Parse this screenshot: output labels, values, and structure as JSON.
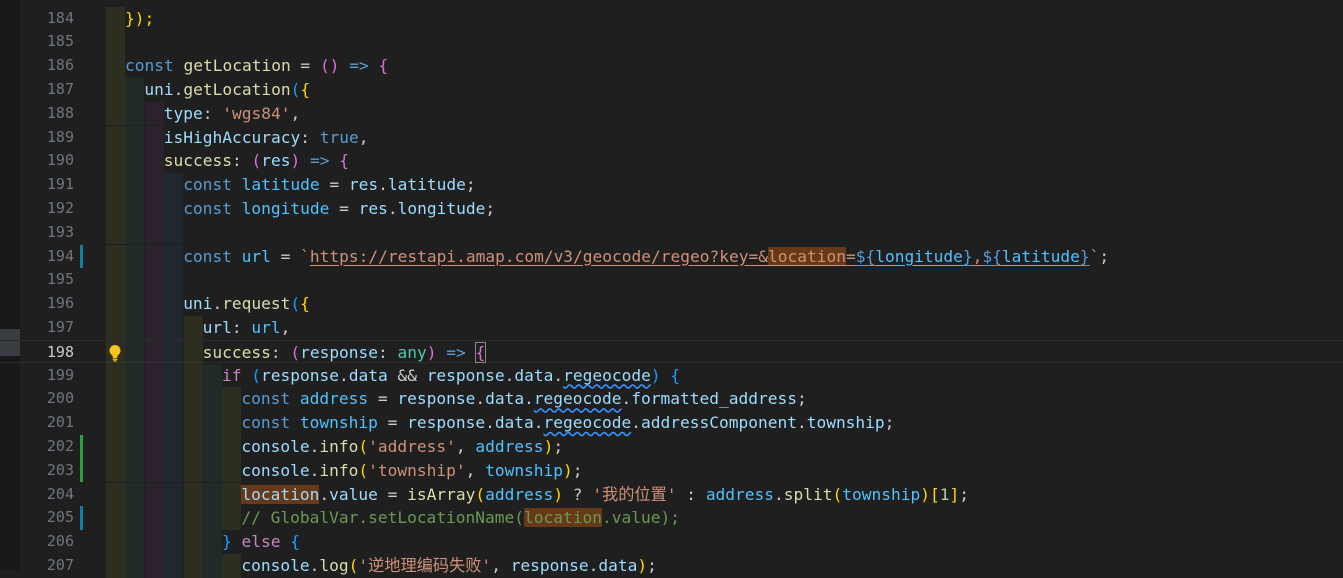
{
  "editor": {
    "lines": [
      {
        "n": "184",
        "indent": 0,
        "tokens": [
          {
            "t": "});",
            "c": "p1"
          }
        ]
      },
      {
        "n": "185",
        "indent": 0,
        "tokens": []
      },
      {
        "n": "186",
        "indent": 0,
        "tokens": [
          {
            "t": "const",
            "c": "kw"
          },
          {
            "t": " "
          },
          {
            "t": "getLocation",
            "c": "fn"
          },
          {
            "t": " = "
          },
          {
            "t": "()",
            "c": "p2"
          },
          {
            "t": " "
          },
          {
            "t": "=>",
            "c": "kw"
          },
          {
            "t": " "
          },
          {
            "t": "{",
            "c": "p2"
          }
        ]
      },
      {
        "n": "187",
        "indent": 1,
        "tokens": [
          {
            "t": "uni",
            "c": "var"
          },
          {
            "t": "."
          },
          {
            "t": "getLocation",
            "c": "fn"
          },
          {
            "t": "(",
            "c": "p3"
          },
          {
            "t": "{",
            "c": "p1"
          }
        ]
      },
      {
        "n": "188",
        "indent": 2,
        "tokens": [
          {
            "t": "type",
            "c": "var"
          },
          {
            "t": ": "
          },
          {
            "t": "'wgs84'",
            "c": "str"
          },
          {
            "t": ","
          }
        ]
      },
      {
        "n": "189",
        "indent": 2,
        "tokens": [
          {
            "t": "isHighAccuracy",
            "c": "var"
          },
          {
            "t": ": "
          },
          {
            "t": "true",
            "c": "kw"
          },
          {
            "t": ","
          }
        ]
      },
      {
        "n": "190",
        "indent": 2,
        "tokens": [
          {
            "t": "success",
            "c": "fn"
          },
          {
            "t": ": "
          },
          {
            "t": "(",
            "c": "p2"
          },
          {
            "t": "res",
            "c": "var"
          },
          {
            "t": ")",
            "c": "p2"
          },
          {
            "t": " "
          },
          {
            "t": "=>",
            "c": "kw"
          },
          {
            "t": " "
          },
          {
            "t": "{",
            "c": "p2"
          }
        ]
      },
      {
        "n": "191",
        "indent": 3,
        "tokens": [
          {
            "t": "const",
            "c": "kw"
          },
          {
            "t": " "
          },
          {
            "t": "latitude",
            "c": "cst"
          },
          {
            "t": " = "
          },
          {
            "t": "res",
            "c": "var"
          },
          {
            "t": "."
          },
          {
            "t": "latitude",
            "c": "var"
          },
          {
            "t": ";"
          }
        ]
      },
      {
        "n": "192",
        "indent": 3,
        "tokens": [
          {
            "t": "const",
            "c": "kw"
          },
          {
            "t": " "
          },
          {
            "t": "longitude",
            "c": "cst"
          },
          {
            "t": " = "
          },
          {
            "t": "res",
            "c": "var"
          },
          {
            "t": "."
          },
          {
            "t": "longitude",
            "c": "var"
          },
          {
            "t": ";"
          }
        ]
      },
      {
        "n": "193",
        "indent": 3,
        "tokens": []
      },
      {
        "n": "194",
        "indent": 3,
        "mod": "changed",
        "tokens": [
          {
            "t": "const",
            "c": "kw"
          },
          {
            "t": " "
          },
          {
            "t": "url",
            "c": "cst"
          },
          {
            "t": " = "
          },
          {
            "t": "`",
            "c": "str"
          },
          {
            "t": "https://restapi.amap.com/v3/geocode/regeo?key=&",
            "c": "str link"
          },
          {
            "t": "location",
            "c": "str link hl"
          },
          {
            "t": "=",
            "c": "str link"
          },
          {
            "t": "${",
            "c": "kw link"
          },
          {
            "t": "longitude",
            "c": "cst link"
          },
          {
            "t": "}",
            "c": "kw link"
          },
          {
            "t": ",",
            "c": "str link"
          },
          {
            "t": "${",
            "c": "kw link"
          },
          {
            "t": "latitude",
            "c": "cst link"
          },
          {
            "t": "}",
            "c": "kw link"
          },
          {
            "t": "`",
            "c": "str"
          },
          {
            "t": ";"
          }
        ]
      },
      {
        "n": "195",
        "indent": 3,
        "tokens": []
      },
      {
        "n": "196",
        "indent": 3,
        "tokens": [
          {
            "t": "uni",
            "c": "var"
          },
          {
            "t": "."
          },
          {
            "t": "request",
            "c": "fn"
          },
          {
            "t": "(",
            "c": "p3"
          },
          {
            "t": "{",
            "c": "p1"
          }
        ]
      },
      {
        "n": "197",
        "indent": 4,
        "tokens": [
          {
            "t": "url",
            "c": "var"
          },
          {
            "t": ": "
          },
          {
            "t": "url",
            "c": "cst"
          },
          {
            "t": ","
          }
        ]
      },
      {
        "n": "198",
        "indent": 4,
        "current": true,
        "bulb": true,
        "tokens": [
          {
            "t": "success",
            "c": "fn"
          },
          {
            "t": ": "
          },
          {
            "t": "(",
            "c": "p2"
          },
          {
            "t": "response",
            "c": "var"
          },
          {
            "t": ": "
          },
          {
            "t": "any",
            "c": "typ"
          },
          {
            "t": ")",
            "c": "p2"
          },
          {
            "t": " "
          },
          {
            "t": "=>",
            "c": "kw"
          },
          {
            "t": " "
          },
          {
            "t": "{",
            "c": "p2 bracket-box"
          }
        ]
      },
      {
        "n": "199",
        "indent": 5,
        "tokens": [
          {
            "t": "if",
            "c": "ctl"
          },
          {
            "t": " "
          },
          {
            "t": "(",
            "c": "p3"
          },
          {
            "t": "response",
            "c": "var"
          },
          {
            "t": "."
          },
          {
            "t": "data",
            "c": "var"
          },
          {
            "t": " && "
          },
          {
            "t": "response",
            "c": "var"
          },
          {
            "t": "."
          },
          {
            "t": "data",
            "c": "var"
          },
          {
            "t": "."
          },
          {
            "t": "regeocode",
            "c": "var squig"
          },
          {
            "t": ")",
            "c": "p3"
          },
          {
            "t": " "
          },
          {
            "t": "{",
            "c": "p3"
          }
        ]
      },
      {
        "n": "200",
        "indent": 6,
        "tokens": [
          {
            "t": "const",
            "c": "kw"
          },
          {
            "t": " "
          },
          {
            "t": "address",
            "c": "cst"
          },
          {
            "t": " = "
          },
          {
            "t": "response",
            "c": "var"
          },
          {
            "t": "."
          },
          {
            "t": "data",
            "c": "var"
          },
          {
            "t": "."
          },
          {
            "t": "regeocode",
            "c": "var squig"
          },
          {
            "t": "."
          },
          {
            "t": "formatted_address",
            "c": "var"
          },
          {
            "t": ";"
          }
        ]
      },
      {
        "n": "201",
        "indent": 6,
        "tokens": [
          {
            "t": "const",
            "c": "kw"
          },
          {
            "t": " "
          },
          {
            "t": "township",
            "c": "cst"
          },
          {
            "t": " = "
          },
          {
            "t": "response",
            "c": "var"
          },
          {
            "t": "."
          },
          {
            "t": "data",
            "c": "var"
          },
          {
            "t": "."
          },
          {
            "t": "regeocode",
            "c": "var squig"
          },
          {
            "t": "."
          },
          {
            "t": "addressComponent",
            "c": "var"
          },
          {
            "t": "."
          },
          {
            "t": "township",
            "c": "var"
          },
          {
            "t": ";"
          }
        ]
      },
      {
        "n": "202",
        "indent": 6,
        "mod": "added",
        "tokens": [
          {
            "t": "console",
            "c": "var"
          },
          {
            "t": "."
          },
          {
            "t": "info",
            "c": "fn"
          },
          {
            "t": "(",
            "c": "p1"
          },
          {
            "t": "'address'",
            "c": "str"
          },
          {
            "t": ", "
          },
          {
            "t": "address",
            "c": "cst"
          },
          {
            "t": ")",
            "c": "p1"
          },
          {
            "t": ";"
          }
        ]
      },
      {
        "n": "203",
        "indent": 6,
        "mod": "added",
        "tokens": [
          {
            "t": "console",
            "c": "var"
          },
          {
            "t": "."
          },
          {
            "t": "info",
            "c": "fn"
          },
          {
            "t": "(",
            "c": "p1"
          },
          {
            "t": "'township'",
            "c": "str"
          },
          {
            "t": ", "
          },
          {
            "t": "township",
            "c": "cst"
          },
          {
            "t": ")",
            "c": "p1"
          },
          {
            "t": ";"
          }
        ]
      },
      {
        "n": "204",
        "indent": 6,
        "tokens": [
          {
            "t": "location",
            "c": "var hl"
          },
          {
            "t": "."
          },
          {
            "t": "value",
            "c": "var"
          },
          {
            "t": " = "
          },
          {
            "t": "isArray",
            "c": "fn"
          },
          {
            "t": "(",
            "c": "p1"
          },
          {
            "t": "address",
            "c": "cst"
          },
          {
            "t": ")",
            "c": "p1"
          },
          {
            "t": " ? "
          },
          {
            "t": "'我的位置'",
            "c": "str"
          },
          {
            "t": " : "
          },
          {
            "t": "address",
            "c": "cst"
          },
          {
            "t": "."
          },
          {
            "t": "split",
            "c": "fn"
          },
          {
            "t": "(",
            "c": "p1"
          },
          {
            "t": "township",
            "c": "cst"
          },
          {
            "t": ")",
            "c": "p1"
          },
          {
            "t": "[",
            "c": "p1"
          },
          {
            "t": "1",
            "c": "num"
          },
          {
            "t": "]",
            "c": "p1"
          },
          {
            "t": ";"
          }
        ]
      },
      {
        "n": "205",
        "indent": 6,
        "mod": "changed",
        "tokens": [
          {
            "t": "// GlobalVar.setLocationName(",
            "c": "cmt"
          },
          {
            "t": "location",
            "c": "cmt hl"
          },
          {
            "t": ".value);",
            "c": "cmt"
          }
        ]
      },
      {
        "n": "206",
        "indent": 5,
        "tokens": [
          {
            "t": "}",
            "c": "p3"
          },
          {
            "t": " "
          },
          {
            "t": "else",
            "c": "ctl"
          },
          {
            "t": " "
          },
          {
            "t": "{",
            "c": "p3"
          }
        ]
      },
      {
        "n": "207",
        "indent": 6,
        "tokens": [
          {
            "t": "console",
            "c": "var"
          },
          {
            "t": "."
          },
          {
            "t": "log",
            "c": "fn"
          },
          {
            "t": "(",
            "c": "p1"
          },
          {
            "t": "'逆地理编码失败'",
            "c": "str"
          },
          {
            "t": ", "
          },
          {
            "t": "response",
            "c": "var"
          },
          {
            "t": "."
          },
          {
            "t": "data",
            "c": "var"
          },
          {
            "t": ")",
            "c": "p1"
          },
          {
            "t": ";"
          }
        ]
      }
    ]
  }
}
